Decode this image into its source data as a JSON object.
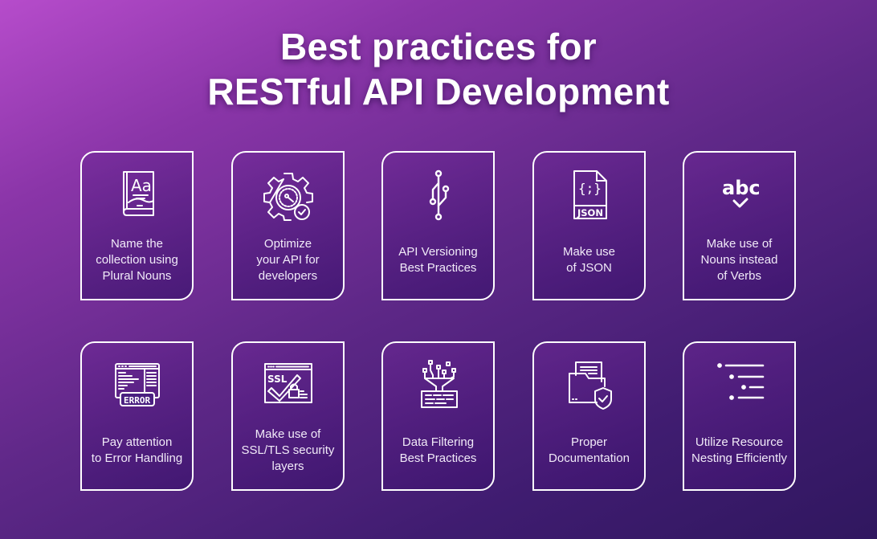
{
  "title": {
    "line1": "Best practices for",
    "line2": "RESTful API Development"
  },
  "colors": {
    "background_start": "#b64ccb",
    "background_end": "#30175f",
    "card_border": "#ffffff",
    "text": "#ffffff"
  },
  "cards": [
    {
      "icon": "book-icon",
      "lines": [
        "Name the",
        "collection using",
        "Plural Nouns"
      ]
    },
    {
      "icon": "gear-gauge-check-icon",
      "lines": [
        "Optimize",
        "your API for",
        "developers"
      ]
    },
    {
      "icon": "version-branch-icon",
      "lines": [
        "API Versioning",
        "Best Practices"
      ]
    },
    {
      "icon": "json-file-icon",
      "lines": [
        "Make use",
        "of JSON"
      ]
    },
    {
      "icon": "abc-check-icon",
      "lines": [
        "Make use of",
        "Nouns instead",
        "of Verbs"
      ]
    },
    {
      "icon": "error-window-icon",
      "lines": [
        "Pay attention",
        "to Error Handling"
      ]
    },
    {
      "icon": "ssl-window-icon",
      "lines": [
        "Make use of",
        "SSL/TLS security",
        "layers"
      ]
    },
    {
      "icon": "data-filter-icon",
      "lines": [
        "Data Filtering",
        "Best Practices"
      ]
    },
    {
      "icon": "folder-shield-icon",
      "lines": [
        "Proper",
        "Documentation"
      ]
    },
    {
      "icon": "nested-list-icon",
      "lines": [
        "Utilize Resource",
        "Nesting Efficiently"
      ]
    }
  ]
}
